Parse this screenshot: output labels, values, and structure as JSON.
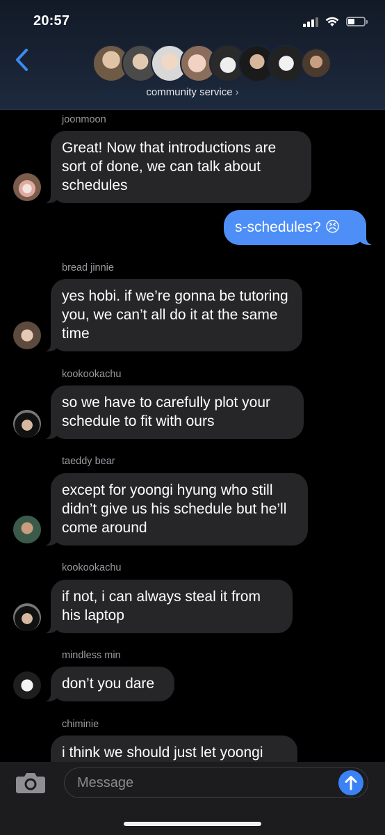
{
  "status_bar": {
    "time": "20:57"
  },
  "header": {
    "group_name": "community service",
    "chevron": "›"
  },
  "messages": [
    {
      "sender": "joonmoon",
      "text": "Great! Now that introductions are sort of done, we can talk about schedules"
    },
    {
      "sender": "",
      "text": "s-schedules? 😣",
      "outgoing": true
    },
    {
      "sender": "bread jinnie",
      "text": "yes hobi. if we’re gonna be tutoring you, we can’t all do it at the same time"
    },
    {
      "sender": "kookookachu",
      "text": "so we have to carefully plot your schedule to fit with ours"
    },
    {
      "sender": "taeddy bear",
      "text": "except for yoongi hyung who still didn’t give us his schedule but he’ll come around"
    },
    {
      "sender": "kookookachu",
      "text": "if not, i can always steal it from his laptop"
    },
    {
      "sender": "mindless min",
      "text": "don’t you dare"
    },
    {
      "sender": "chiminie",
      "text": "i think we should just let yoongi"
    }
  ],
  "composer": {
    "placeholder": "Message"
  },
  "colors": {
    "incoming_bubble": "#262628",
    "outgoing_bubble": "#4e8ff7",
    "accent": "#3a82f6",
    "back_chevron": "#3d8bf2"
  }
}
